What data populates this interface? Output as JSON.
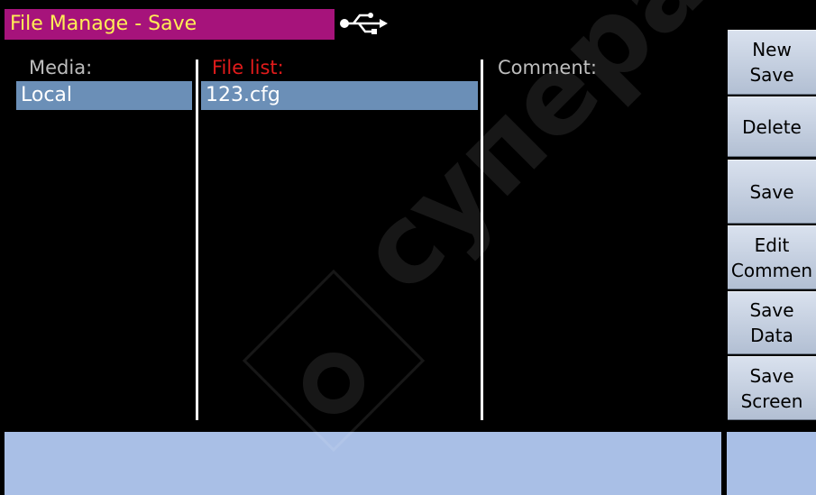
{
  "title": "File Manage - Save",
  "icons": {
    "usb": "usb-icon"
  },
  "columns": {
    "media_header": "Media:",
    "file_list_header": "File list:",
    "comment_header": "Comment:"
  },
  "media": {
    "selected": "Local"
  },
  "file_list": {
    "selected": "123.cfg"
  },
  "softkeys": {
    "new_save": [
      "New",
      "Save"
    ],
    "delete": "Delete",
    "save": "Save",
    "edit_comment": [
      "Edit",
      "Commen"
    ],
    "save_data": [
      "Save",
      "Data"
    ],
    "save_screen": [
      "Save",
      "Screen"
    ]
  },
  "watermark_text": "суперайс",
  "colors": {
    "title_bg": "#a6137b",
    "title_text": "#ffee55",
    "selection_bg": "#6b8fb7",
    "active_header": "#e21b1b",
    "status_bar": "#a9bfe6"
  }
}
